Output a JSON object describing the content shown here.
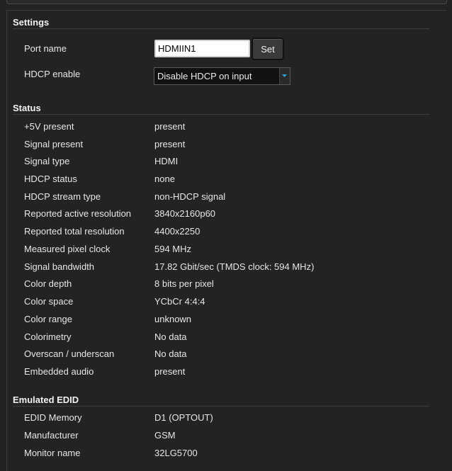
{
  "settings": {
    "title": "Settings",
    "port_name_label": "Port name",
    "port_name_value": "HDMIIN1",
    "set_button": "Set",
    "hdcp_enable_label": "HDCP enable",
    "hdcp_enable_selected": "Disable HDCP on input"
  },
  "status": {
    "title": "Status",
    "rows": [
      {
        "label": "+5V present",
        "value": "present"
      },
      {
        "label": "Signal present",
        "value": "present"
      },
      {
        "label": "Signal type",
        "value": "HDMI"
      },
      {
        "label": "HDCP status",
        "value": "none"
      },
      {
        "label": "HDCP stream type",
        "value": "non-HDCP signal"
      },
      {
        "label": "Reported active resolution",
        "value": "3840x2160p60"
      },
      {
        "label": "Reported total resolution",
        "value": "4400x2250"
      },
      {
        "label": "Measured pixel clock",
        "value": "594 MHz"
      },
      {
        "label": "Signal bandwidth",
        "value": "17.82 Gbit/sec (TMDS clock: 594 MHz)"
      },
      {
        "label": "Color depth",
        "value": "8 bits per pixel"
      },
      {
        "label": "Color space",
        "value": "YCbCr 4:4:4"
      },
      {
        "label": "Color range",
        "value": "unknown"
      },
      {
        "label": "Colorimetry",
        "value": "No data"
      },
      {
        "label": "Overscan / underscan",
        "value": "No data"
      },
      {
        "label": "Embedded audio",
        "value": "present"
      }
    ]
  },
  "emulated_edid": {
    "title": "Emulated EDID",
    "rows": [
      {
        "label": "EDID Memory",
        "value": "D1 (OPTOUT)"
      },
      {
        "label": "Manufacturer",
        "value": "GSM"
      },
      {
        "label": "Monitor name",
        "value": "32LG5700"
      }
    ]
  },
  "colors": {
    "background": "#222222",
    "text": "#e6e6e6",
    "select_arrow": "#29a3d6"
  }
}
